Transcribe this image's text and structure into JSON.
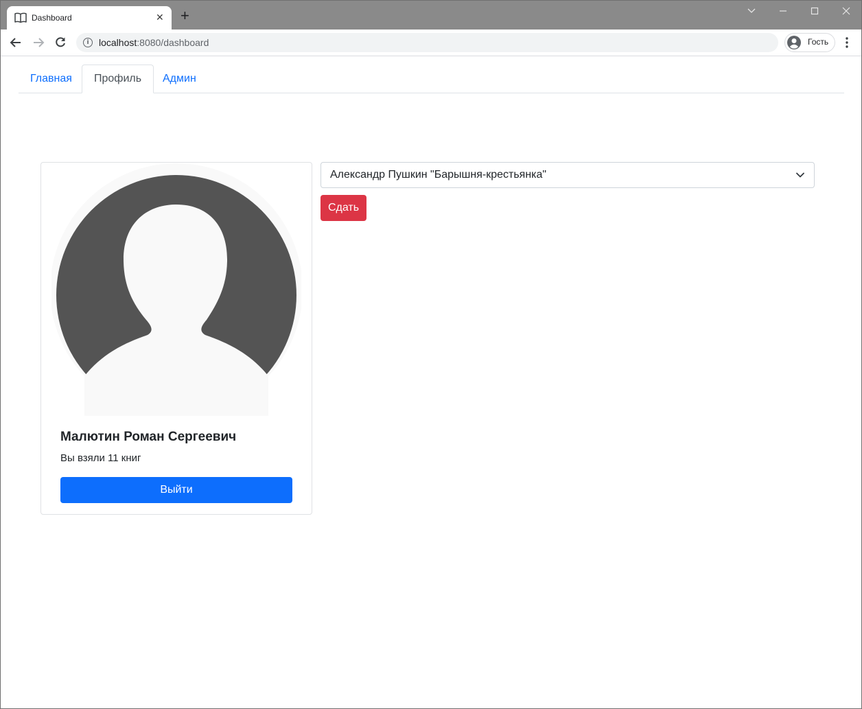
{
  "browser": {
    "tab_title": "Dashboard",
    "tab_close": "✕",
    "new_tab": "+",
    "url_host": "localhost",
    "url_rest": ":8080/dashboard",
    "profile_label": "Гость"
  },
  "nav": {
    "tabs": [
      {
        "label": "Главная",
        "active": false
      },
      {
        "label": "Профиль",
        "active": true
      },
      {
        "label": "Админ",
        "active": false
      }
    ]
  },
  "profile": {
    "name": "Малютин Роман Сергеевич",
    "books_taken": "Вы взяли 11 книг",
    "logout_label": "Выйти"
  },
  "return_form": {
    "selected_book": "Александр Пушкин \"Барышня-крестьянка\"",
    "return_label": "Сдать"
  },
  "colors": {
    "primary": "#0d6efd",
    "danger": "#dc3545",
    "avatar_dark": "#545454",
    "avatar_light": "#f9f9f9"
  }
}
